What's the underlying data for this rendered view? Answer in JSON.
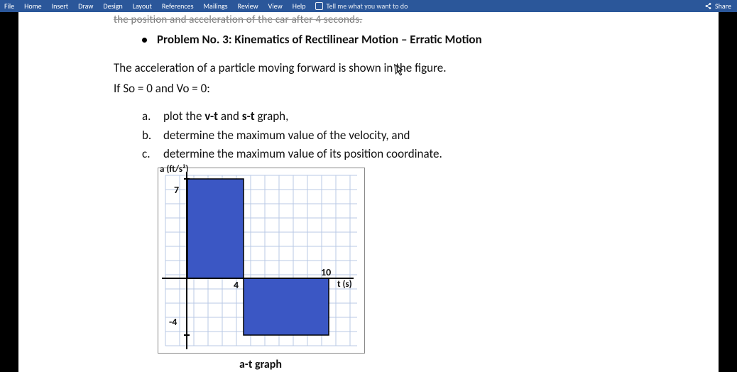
{
  "ribbon": {
    "tabs": [
      "File",
      "Home",
      "Insert",
      "Draw",
      "Design",
      "Layout",
      "References",
      "Mailings",
      "Review",
      "View",
      "Help"
    ],
    "tell_me": "Tell me what you want to do",
    "share": "Share"
  },
  "document": {
    "cutoff_prev_line": "the position and acceleration of the car after 4 seconds.",
    "heading": "Problem No. 3: Kinematics of Rectilinear Motion – Erratic Motion",
    "para1": "The acceleration of a particle moving forward is shown in the figure.",
    "para2": "If So = 0 and Vo = 0:",
    "list": {
      "a_label": "a.",
      "a_text_pre": "plot the ",
      "a_text_bold1": "v-t",
      "a_text_mid": " and ",
      "a_text_bold2": "s-t",
      "a_text_post": " graph,",
      "b_label": "b.",
      "b_text": "determine the maximum value of the velocity, and",
      "c_label": "c.",
      "c_text": "determine the maximum value of its position coordinate."
    },
    "chart": {
      "y_axis_label": "a (ft/s²)",
      "x_axis_label": "t (s)",
      "tick_y_top": "7",
      "tick_y_bot": "-4",
      "tick_x_mid": "4",
      "tick_x_end": "10",
      "caption": "a-t graph"
    }
  },
  "chart_data": {
    "type": "bar",
    "title": "a-t graph",
    "xlabel": "t (s)",
    "ylabel": "a (ft/s²)",
    "xlim": [
      0,
      10
    ],
    "ylim": [
      -4,
      7
    ],
    "segments": [
      {
        "t_start": 0,
        "t_end": 4,
        "a": 7
      },
      {
        "t_start": 4,
        "t_end": 10,
        "a": -4
      }
    ]
  }
}
